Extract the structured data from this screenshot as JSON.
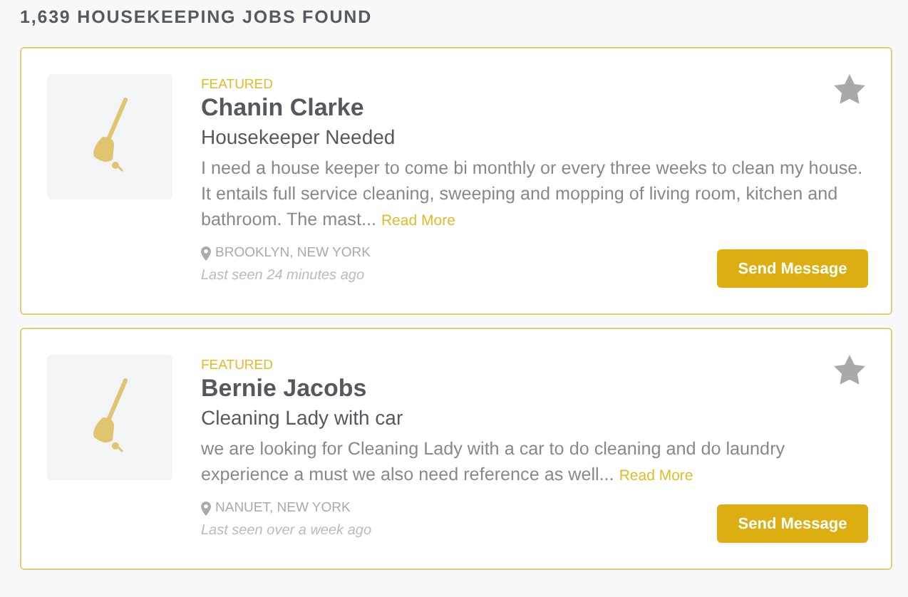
{
  "heading": "1,639 HOUSEKEEPING JOBS FOUND",
  "jobs": [
    {
      "badge": "FEATURED",
      "name": "Chanin Clarke",
      "title": "Housekeeper Needed",
      "description": "I need a house keeper to come bi monthly or every three weeks to clean my house. It entails full service cleaning, sweeping and mopping of living room, kitchen and bathroom. The mast...",
      "read_more": "Read More",
      "location": "BROOKLYN, NEW YORK",
      "last_seen": "Last seen 24 minutes ago",
      "button": "Send Message"
    },
    {
      "badge": "FEATURED",
      "name": "Bernie Jacobs",
      "title": "Cleaning Lady with car",
      "description": "we are looking for Cleaning Lady with a car to do cleaning and do laundry experience a must we also need reference as well...",
      "read_more": "Read More",
      "location": "NANUET, NEW YORK",
      "last_seen": "Last seen over a week ago",
      "button": "Send Message"
    }
  ]
}
